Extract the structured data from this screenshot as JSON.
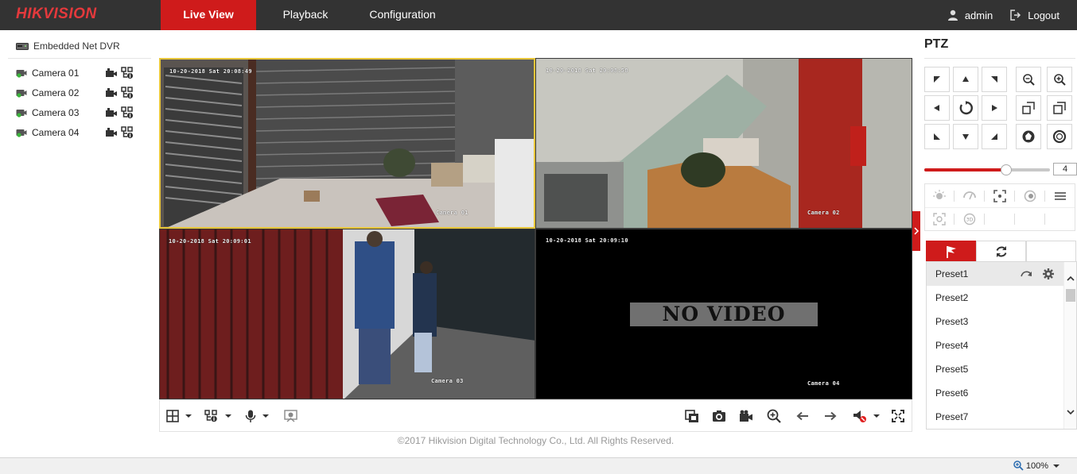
{
  "brand": {
    "logo": "HIKVISION",
    "accent": "#cf1b1b"
  },
  "nav": {
    "tabs": [
      {
        "label": "Live View",
        "active": true
      },
      {
        "label": "Playback",
        "active": false
      },
      {
        "label": "Configuration",
        "active": false
      }
    ],
    "user": {
      "name": "admin",
      "icon": "user-icon"
    },
    "logout": {
      "label": "Logout",
      "icon": "logout-icon"
    }
  },
  "tree": {
    "device": "Embedded Net DVR",
    "cameras": [
      {
        "label": "Camera 01"
      },
      {
        "label": "Camera 02"
      },
      {
        "label": "Camera 03"
      },
      {
        "label": "Camera 04"
      }
    ]
  },
  "video": {
    "tiles": [
      {
        "time": "10-20-2018 Sat 20:08:49",
        "name": "Camera 01",
        "selected": true
      },
      {
        "time": "10-20-2018 Sat 20:08:58",
        "name": "Camera 02",
        "selected": false
      },
      {
        "time": "10-20-2018 Sat 20:09:01",
        "name": "Camera 03",
        "selected": false
      },
      {
        "time": "10-20-2018 Sat 20:09:10",
        "name": "Camera 04",
        "selected": false,
        "no_video": "NO VIDEO"
      }
    ]
  },
  "footer": {
    "copyright": "©2017 Hikvision Digital Technology Co., Ltd. All Rights Reserved."
  },
  "ptz": {
    "title": "PTZ",
    "speed": "4",
    "speed_level": 0.65,
    "presets": [
      {
        "label": "Preset1"
      },
      {
        "label": "Preset2"
      },
      {
        "label": "Preset3"
      },
      {
        "label": "Preset4"
      },
      {
        "label": "Preset5"
      },
      {
        "label": "Preset6"
      },
      {
        "label": "Preset7"
      }
    ]
  },
  "statusbar": {
    "zoom": "100%"
  }
}
